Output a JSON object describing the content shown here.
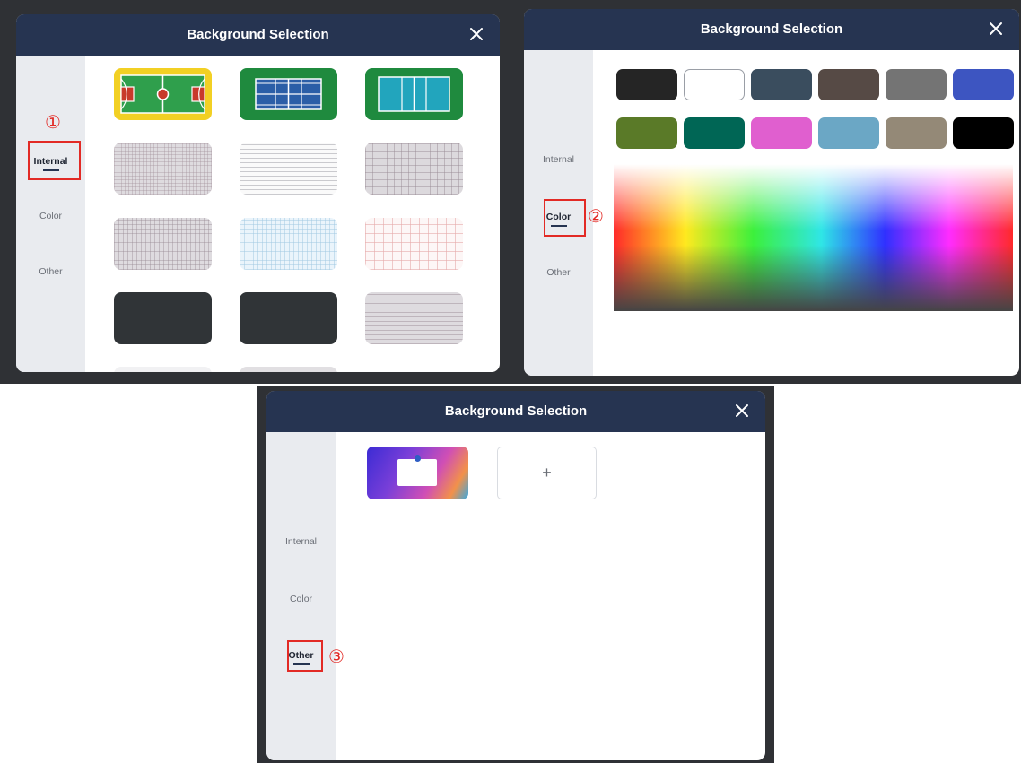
{
  "title": "Background Selection",
  "nav": {
    "internal": "Internal",
    "color": "Color",
    "other": "Other"
  },
  "markers": {
    "one": "①",
    "two": "②",
    "three": "③"
  },
  "internal_thumbnails": [
    "basketball-court",
    "badminton-court",
    "volleyball-court",
    "gray-fine-grid",
    "white-ruled-lines",
    "gray-large-grid",
    "gray-dense-grid",
    "light-blue-grid",
    "pink-grid",
    "dark-board",
    "dark-board",
    "gray-ruled-lines"
  ],
  "color_swatches": [
    "#252525",
    "#ffffff",
    "#3a4d5e",
    "#564a45",
    "#747474",
    "#3d55c1",
    "#5a7a28",
    "#006655",
    "#e05fcf",
    "#6ba7c5",
    "#948977",
    "#000000"
  ],
  "other": {
    "add_label": "+"
  },
  "accent": "#263451",
  "highlight": "#e22a25"
}
